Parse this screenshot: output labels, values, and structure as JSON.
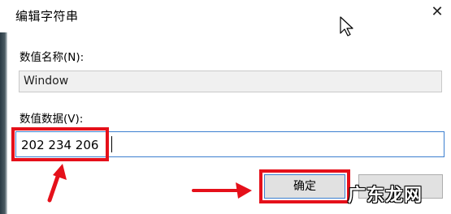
{
  "dialog": {
    "title": "编辑字符串",
    "close_icon": "close-icon",
    "name_label": "数值名称(N):",
    "name_value": "Window",
    "data_label": "数值数据(V):",
    "data_value": "202 234 206",
    "ok_label": "确定",
    "cancel_label": ""
  },
  "watermark": {
    "text": "广东龙网"
  },
  "colors": {
    "highlight": "#e5101a",
    "focus_border": "#3c7fd0",
    "readonly_field": "#f0f0f0",
    "button": "#e1e1e1"
  }
}
